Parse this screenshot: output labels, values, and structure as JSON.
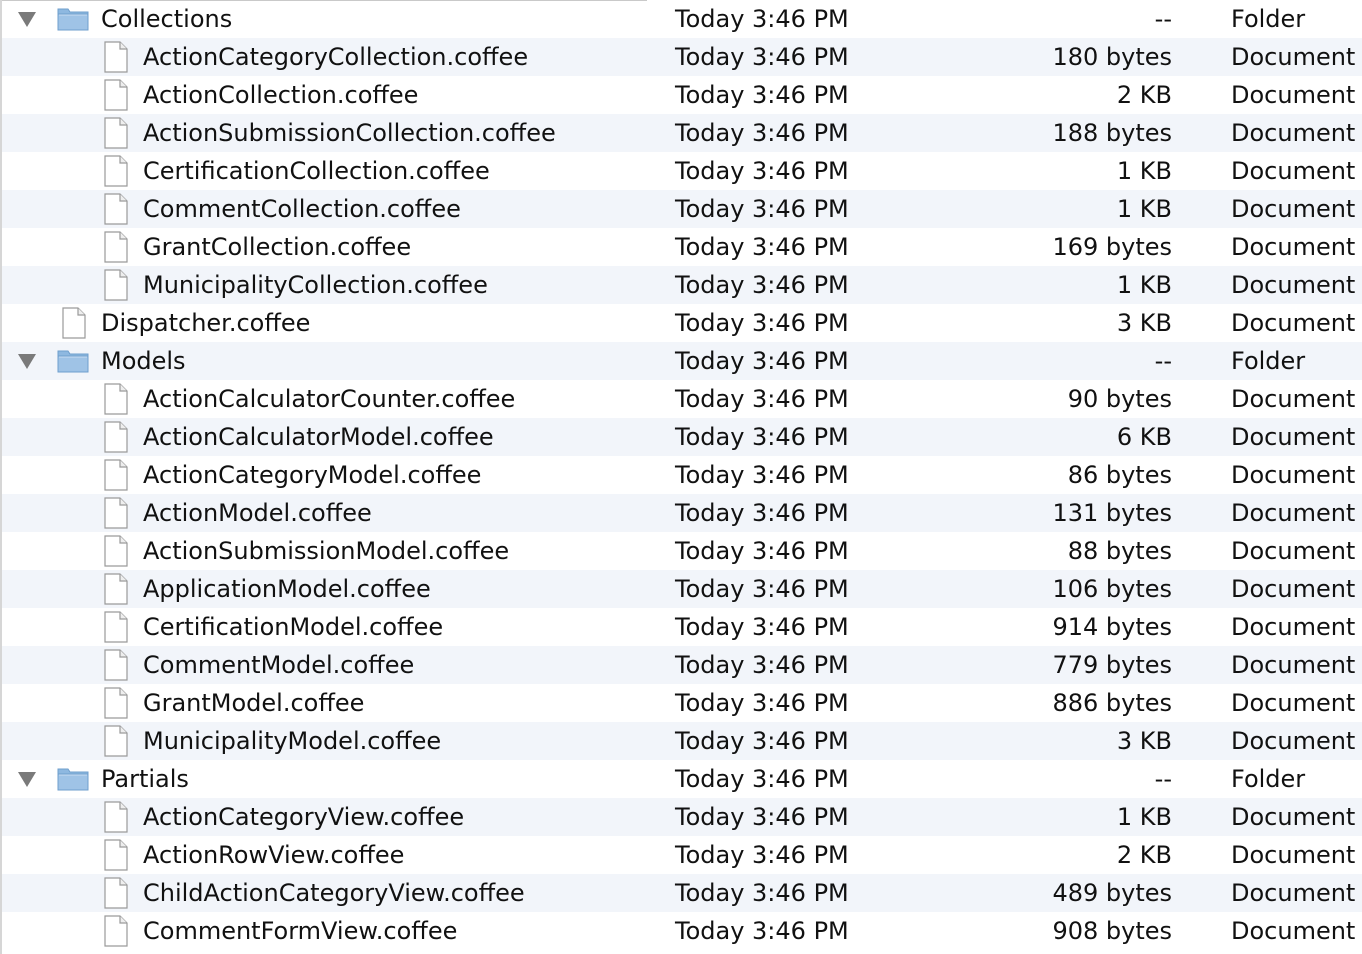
{
  "window": {
    "title_hidden": ""
  },
  "colors": {
    "alt_row": "#f2f5fa",
    "folder": "#9fc3e6",
    "text": "#111111"
  },
  "rows": [
    {
      "type": "folder",
      "level": 0,
      "name": "Collections",
      "date": "Today 3:46 PM",
      "size": "--",
      "kind": "Folder",
      "icon": "folder-icon",
      "expanded": true
    },
    {
      "type": "file",
      "level": 1,
      "name": "ActionCategoryCollection.coffee",
      "date": "Today 3:46 PM",
      "size": "180 bytes",
      "kind": "Document",
      "icon": "document-icon"
    },
    {
      "type": "file",
      "level": 1,
      "name": "ActionCollection.coffee",
      "date": "Today 3:46 PM",
      "size": "2 KB",
      "kind": "Document",
      "icon": "document-icon"
    },
    {
      "type": "file",
      "level": 1,
      "name": "ActionSubmissionCollection.coffee",
      "date": "Today 3:46 PM",
      "size": "188 bytes",
      "kind": "Document",
      "icon": "document-icon"
    },
    {
      "type": "file",
      "level": 1,
      "name": "CertificationCollection.coffee",
      "date": "Today 3:46 PM",
      "size": "1 KB",
      "kind": "Document",
      "icon": "document-icon"
    },
    {
      "type": "file",
      "level": 1,
      "name": "CommentCollection.coffee",
      "date": "Today 3:46 PM",
      "size": "1 KB",
      "kind": "Document",
      "icon": "document-icon"
    },
    {
      "type": "file",
      "level": 1,
      "name": "GrantCollection.coffee",
      "date": "Today 3:46 PM",
      "size": "169 bytes",
      "kind": "Document",
      "icon": "document-icon"
    },
    {
      "type": "file",
      "level": 1,
      "name": "MunicipalityCollection.coffee",
      "date": "Today 3:46 PM",
      "size": "1 KB",
      "kind": "Document",
      "icon": "document-icon"
    },
    {
      "type": "file",
      "level": 0,
      "name": "Dispatcher.coffee",
      "date": "Today 3:46 PM",
      "size": "3 KB",
      "kind": "Document",
      "icon": "document-icon"
    },
    {
      "type": "folder",
      "level": 0,
      "name": "Models",
      "date": "Today 3:46 PM",
      "size": "--",
      "kind": "Folder",
      "icon": "folder-icon",
      "expanded": true
    },
    {
      "type": "file",
      "level": 1,
      "name": "ActionCalculatorCounter.coffee",
      "date": "Today 3:46 PM",
      "size": "90 bytes",
      "kind": "Document",
      "icon": "document-icon"
    },
    {
      "type": "file",
      "level": 1,
      "name": "ActionCalculatorModel.coffee",
      "date": "Today 3:46 PM",
      "size": "6 KB",
      "kind": "Document",
      "icon": "document-icon"
    },
    {
      "type": "file",
      "level": 1,
      "name": "ActionCategoryModel.coffee",
      "date": "Today 3:46 PM",
      "size": "86 bytes",
      "kind": "Document",
      "icon": "document-icon"
    },
    {
      "type": "file",
      "level": 1,
      "name": "ActionModel.coffee",
      "date": "Today 3:46 PM",
      "size": "131 bytes",
      "kind": "Document",
      "icon": "document-icon"
    },
    {
      "type": "file",
      "level": 1,
      "name": "ActionSubmissionModel.coffee",
      "date": "Today 3:46 PM",
      "size": "88 bytes",
      "kind": "Document",
      "icon": "document-icon"
    },
    {
      "type": "file",
      "level": 1,
      "name": "ApplicationModel.coffee",
      "date": "Today 3:46 PM",
      "size": "106 bytes",
      "kind": "Document",
      "icon": "document-icon"
    },
    {
      "type": "file",
      "level": 1,
      "name": "CertificationModel.coffee",
      "date": "Today 3:46 PM",
      "size": "914 bytes",
      "kind": "Document",
      "icon": "document-icon"
    },
    {
      "type": "file",
      "level": 1,
      "name": "CommentModel.coffee",
      "date": "Today 3:46 PM",
      "size": "779 bytes",
      "kind": "Document",
      "icon": "document-icon"
    },
    {
      "type": "file",
      "level": 1,
      "name": "GrantModel.coffee",
      "date": "Today 3:46 PM",
      "size": "886 bytes",
      "kind": "Document",
      "icon": "document-icon"
    },
    {
      "type": "file",
      "level": 1,
      "name": "MunicipalityModel.coffee",
      "date": "Today 3:46 PM",
      "size": "3 KB",
      "kind": "Document",
      "icon": "document-icon"
    },
    {
      "type": "folder",
      "level": 0,
      "name": "Partials",
      "date": "Today 3:46 PM",
      "size": "--",
      "kind": "Folder",
      "icon": "folder-icon",
      "expanded": true
    },
    {
      "type": "file",
      "level": 1,
      "name": "ActionCategoryView.coffee",
      "date": "Today 3:46 PM",
      "size": "1 KB",
      "kind": "Document",
      "icon": "document-icon"
    },
    {
      "type": "file",
      "level": 1,
      "name": "ActionRowView.coffee",
      "date": "Today 3:46 PM",
      "size": "2 KB",
      "kind": "Document",
      "icon": "document-icon"
    },
    {
      "type": "file",
      "level": 1,
      "name": "ChildActionCategoryView.coffee",
      "date": "Today 3:46 PM",
      "size": "489 bytes",
      "kind": "Document",
      "icon": "document-icon"
    },
    {
      "type": "file",
      "level": 1,
      "name": "CommentFormView.coffee",
      "date": "Today 3:46 PM",
      "size": "908 bytes",
      "kind": "Document",
      "icon": "document-icon"
    }
  ]
}
